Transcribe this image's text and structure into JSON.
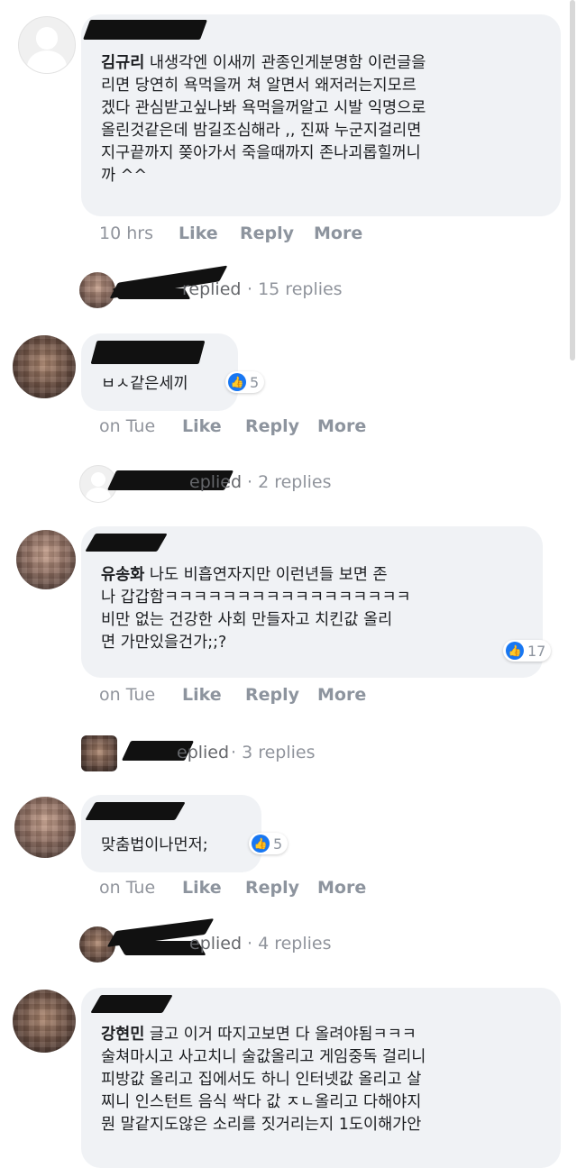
{
  "comments": [
    {
      "author": "김규리",
      "text": " 내생각엔 이새끼 관종인게분명함 이런글을\n리면 당연히 욕먹을꺼 쳐 알면서 왜저러는지모르\n겠다 관심받고싶나봐 욕먹을꺼알고 시발 익명으로\n올린것같은데 밤길조심해라 ,, 진짜 누군지걸리면\n지구끝까지 쫒아가서 죽을때까지 존나괴롭힐꺼니\n까 ^^",
      "time": "10 hrs",
      "like": "Like",
      "reply": "Reply",
      "more": "More",
      "replies_label": "replied",
      "replies_count": "· 15 replies"
    },
    {
      "author": "",
      "text": "ㅂㅅ같은세끼",
      "likes": "5",
      "time": "on Tue",
      "like": "Like",
      "reply": "Reply",
      "more": "More",
      "replies_label": "eplied",
      "replies_count": "· 2 replies"
    },
    {
      "author": "유송화",
      "text": " 나도 비흡연자지만 이런년들 보면 존\n나 갑갑함ㅋㅋㅋㅋㅋㅋㅋㅋㅋㅋㅋㅋㅋㅋㅋㅋㅋ\n비만 없는 건강한 사회 만들자고 치킨값 올리\n면 가만있을건가;;?",
      "likes": "17",
      "time": "on Tue",
      "like": "Like",
      "reply": "Reply",
      "more": "More",
      "replies_label": "eplied",
      "replies_count": "· 3 replies"
    },
    {
      "author": "",
      "text": "맞춤법이나먼저;",
      "likes": "5",
      "time": "on Tue",
      "like": "Like",
      "reply": "Reply",
      "more": "More",
      "replies_label": "eplied",
      "replies_count": "· 4 replies"
    },
    {
      "author": "강현민",
      "text": " 글고 이거 따지고보면 다 올려야됨ㅋㅋㅋ\n술쳐마시고 사고치니 술값올리고 게임중독 걸리니\n피방값 올리고 집에서도 하니 인터넷값 올리고 살\n찌니 인스턴트 음식 싹다 값 ㅈㄴ올리고 다해야지\n뭔 말같지도않은 소리를 짓거리는지 1도이해가안"
    }
  ]
}
